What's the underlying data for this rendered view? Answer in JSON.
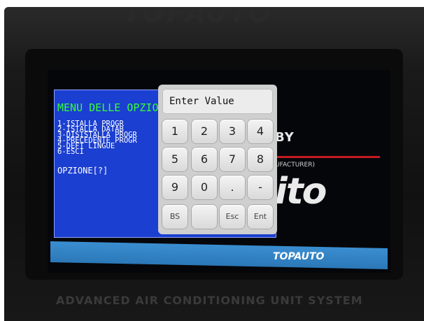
{
  "device": {
    "top_logo": "TOPAUTO",
    "brand_by": "BY",
    "brand_manufacturer": "UFACTURER)",
    "brand_logo": "ito",
    "stripe_logo": "TOPAUTO",
    "bottom_text": "ADVANCED AIR CONDITIONING UNIT SYSTEM"
  },
  "terminal": {
    "title": "MENU DELLE OPZIONI",
    "items": [
      "1-ISTALLA   PROGR",
      "2-ISTALLA   DATAB",
      "3-DISISTALLA PROGR",
      "4-PRECEDENTE PROGR",
      "5-DEFT LINGUE",
      "6-ESCI"
    ],
    "prompt": "OPZIONE[?]"
  },
  "keypad": {
    "display_text": "Enter Value",
    "keys": [
      [
        "1",
        "2",
        "3",
        "4"
      ],
      [
        "5",
        "6",
        "7",
        "8"
      ],
      [
        "9",
        "0",
        ".",
        "-"
      ],
      [
        "BS",
        "",
        "Esc",
        "Ent"
      ]
    ]
  }
}
